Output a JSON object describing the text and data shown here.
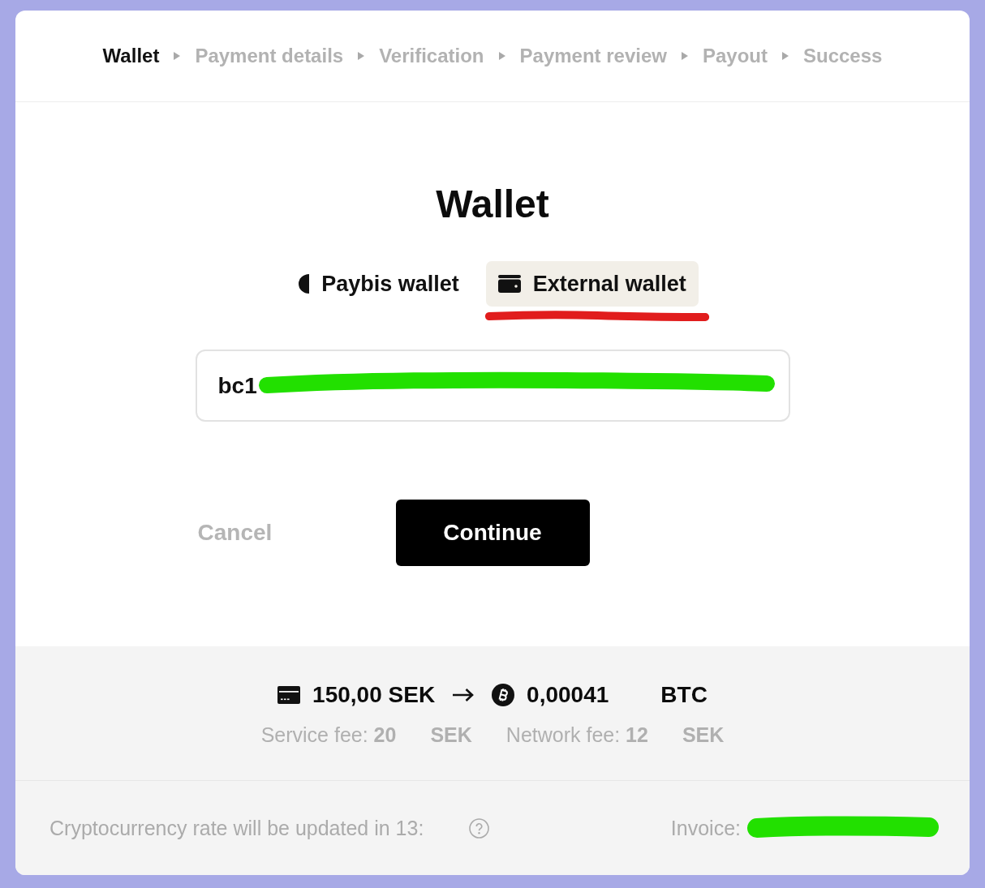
{
  "steps": [
    {
      "label": "Wallet",
      "selected": true
    },
    {
      "label": "Payment details",
      "selected": false
    },
    {
      "label": "Verification",
      "selected": false
    },
    {
      "label": "Payment review",
      "selected": false
    },
    {
      "label": "Payout",
      "selected": false
    },
    {
      "label": "Success",
      "selected": false
    }
  ],
  "title": "Wallet",
  "wallet_tabs": [
    {
      "label": "Paybis wallet",
      "kind": "paybis",
      "selected": false,
      "underlined": false
    },
    {
      "label": "External wallet",
      "kind": "external",
      "selected": true,
      "underlined": true
    }
  ],
  "address_field": {
    "value": "bc1",
    "redacted": true
  },
  "buttons": [
    {
      "label": "Cancel",
      "kind": "cancel"
    },
    {
      "label": "Continue",
      "kind": "continue"
    }
  ],
  "summary": {
    "pay_amount": "150,00 SEK",
    "receive_amount": "0,00041",
    "receive_currency": "BTC",
    "fees": [
      {
        "text": "Service fee: **20**",
        "currency": "SEK"
      },
      {
        "text": "Network fee: **12**",
        "currency": "SEK"
      }
    ]
  },
  "footer": {
    "rate_notice": "Cryptocurrency rate will be updated in 13:",
    "invoice_label": "Invoice:",
    "invoice_redacted": true
  }
}
